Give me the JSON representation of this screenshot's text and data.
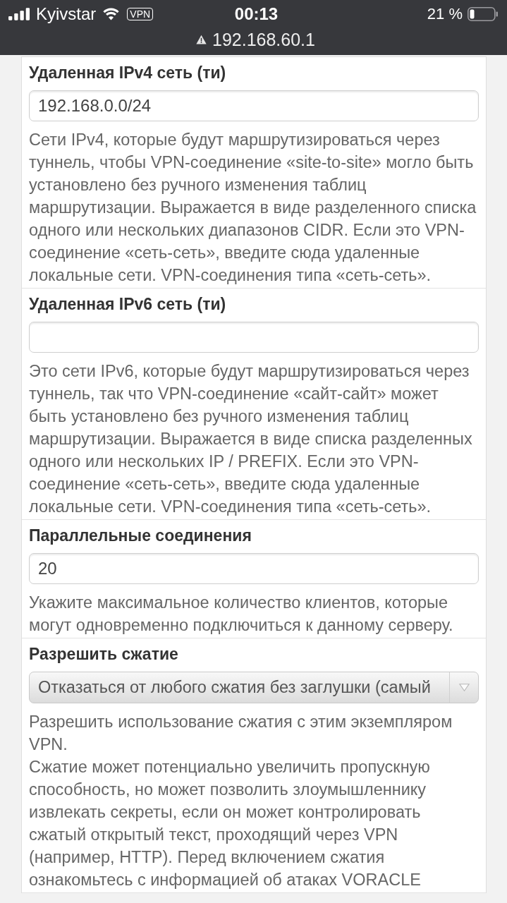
{
  "status_bar": {
    "carrier": "Kyivstar",
    "vpn": "VPN",
    "time": "00:13",
    "battery": "21 %"
  },
  "address_bar": {
    "url": "192.168.60.1"
  },
  "fields": [
    {
      "kind": "text",
      "label": "Удаленная IPv4 сеть (ти)",
      "value": "192.168.0.0/24",
      "help": [
        "Сети IPv4, которые будут маршрутизироваться через туннель, чтобы VPN-соединение «site-to-site» могло быть установлено без ручного изменения таблиц маршрутизации. Выражается в виде разделенного списка одного или нескольких диапазонов CIDR. Если это VPN-соединение «сеть-сеть», введите сюда удаленные локальные сети. VPN-соединения типа «сеть-сеть»."
      ]
    },
    {
      "kind": "text",
      "label": "Удаленная IPv6 сеть (ти)",
      "help": [
        "Это сети IPv6, которые будут маршрутизироваться через туннель, так что VPN-соединение «сайт-сайт» может быть установлено без ручного изменения таблиц маршрутизации. Выражается в виде списка разделенных одного или нескольких IP / PREFIX. Если это VPN-соединение «сеть-сеть», введите сюда удаленные локальные сети. VPN-соединения типа «сеть-сеть»."
      ]
    },
    {
      "kind": "text",
      "label": "Параллельные соединения",
      "value": "20",
      "help": [
        "Укажите максимальное количество клиентов, которые могут одновременно подключиться к данному серверу."
      ]
    },
    {
      "kind": "select",
      "label": "Разрешить сжатие",
      "value": "Отказаться от любого сжатия без заглушки (самый",
      "help": [
        "Разрешить использование сжатия с этим экземпляром VPN.",
        "Сжатие может потенциально увеличить пропускную способность, но может позволить злоумышленнику извлекать секреты, если он может контролировать сжатый открытый текст, проходящий через VPN (например, HTTP). Перед включением сжатия ознакомьтесь с информацией об атаках VORACLE"
      ]
    }
  ]
}
